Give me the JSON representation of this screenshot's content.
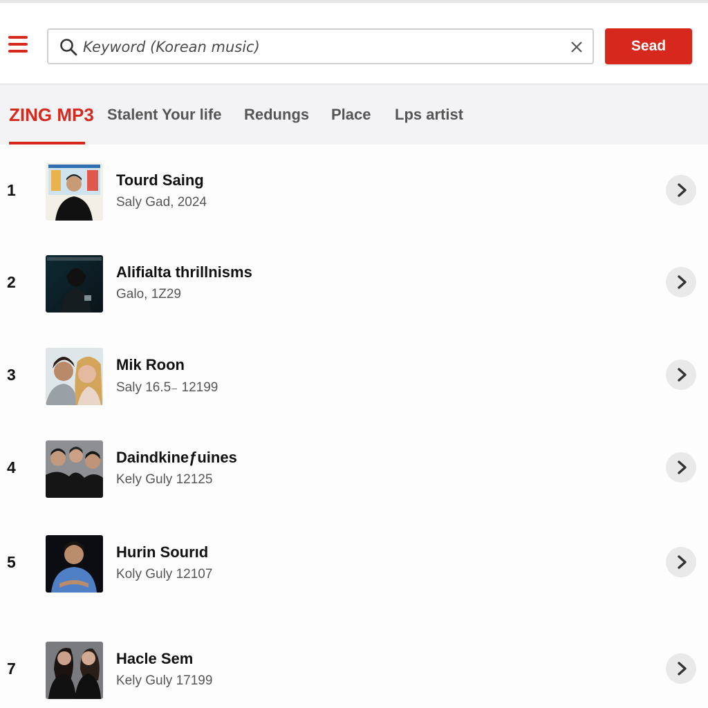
{
  "header": {
    "menu_icon": "hamburger-menu-icon",
    "search": {
      "value": "",
      "placeholder": "Keyword (Korean music)",
      "search_icon": "magnifier-icon",
      "clear_icon": "close-icon"
    },
    "search_button_label": "Sead"
  },
  "tabs": [
    {
      "label": "ZING MP3",
      "active": true
    },
    {
      "label": "Stalent Your life",
      "active": false
    },
    {
      "label": "Redungs",
      "active": false
    },
    {
      "label": "Place",
      "active": false
    },
    {
      "label": "Lps artist",
      "active": false
    }
  ],
  "songs": [
    {
      "rank": "1",
      "title": "Tourd Saing",
      "subtitle": "Saly Gad, 2024"
    },
    {
      "rank": "2",
      "title": "Alifialta thrillnisms",
      "subtitle": "Galo, 1Z29"
    },
    {
      "rank": "3",
      "title": "Mik Roon",
      "subtitle": "Saly 16.5₋ 12199"
    },
    {
      "rank": "4",
      "title": "Daindkineƒuines",
      "subtitle": "Kely Guly 12125"
    },
    {
      "rank": "5",
      "title": "Hurin Sourıd",
      "subtitle": "Koly Guly 12107"
    },
    {
      "rank": "7",
      "title": "Hacle Sem",
      "subtitle": "Kely Guly 17199"
    }
  ],
  "colors": {
    "accent": "#d6281c",
    "tab_bar_bg": "#f3f3f5",
    "chevron_bg": "#e9e9e9"
  }
}
